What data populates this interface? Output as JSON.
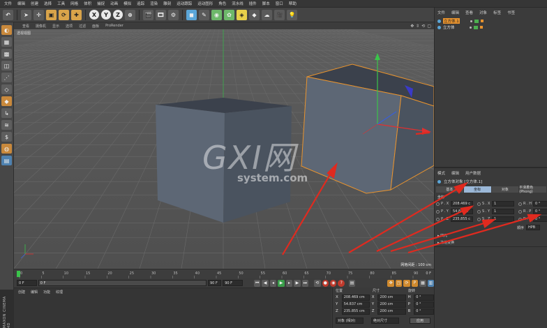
{
  "menubar": [
    "文件",
    "编辑",
    "创建",
    "选择",
    "工具",
    "网格",
    "体积",
    "捕捉",
    "动画",
    "模拟",
    "追踪",
    "渲染",
    "雕刻",
    "运动跟踪",
    "运动图形",
    "角色",
    "流水线",
    "插件",
    "脚本",
    "窗口",
    "帮助"
  ],
  "viewport": {
    "menu": [
      "查看",
      "摄像机",
      "显示",
      "选项",
      "过滤",
      "面板",
      "ProRender"
    ],
    "label": "透视视图",
    "grid_scale": "网格间距 : 100 cm"
  },
  "timeline": {
    "ticks": [
      "0",
      "5",
      "10",
      "15",
      "20",
      "25",
      "30",
      "35",
      "40",
      "45",
      "50",
      "55",
      "60",
      "65",
      "70",
      "75",
      "80",
      "85",
      "90"
    ],
    "end_label": "0 F"
  },
  "transport": {
    "start_frame": "0 F",
    "current_frame": "0 F",
    "end_frame": "90 F",
    "range_end": "90 F"
  },
  "material": {
    "menu": [
      "创建",
      "编辑",
      "功能",
      "纹理"
    ]
  },
  "coordinates": {
    "header_pos": "位置",
    "header_size": "尺寸",
    "header_rot": "旋转",
    "rows": [
      {
        "axis": "X",
        "pos": "208.469 cm",
        "size_axis": "X",
        "size": "200 cm",
        "rot_axis": "H",
        "rot": "0 °"
      },
      {
        "axis": "Y",
        "pos": "54.837 cm",
        "size_axis": "Y",
        "size": "200 cm",
        "rot_axis": "P",
        "rot": "0 °"
      },
      {
        "axis": "Z",
        "pos": "235.855 cm",
        "size_axis": "Z",
        "size": "200 cm",
        "rot_axis": "B",
        "rot": "0 °"
      }
    ],
    "mode": "对象 (相对)",
    "size_mode": "绝对尺寸",
    "apply": "应用"
  },
  "objects": {
    "menu": [
      "文件",
      "编辑",
      "查看",
      "对象",
      "标签",
      "书签"
    ],
    "items": [
      {
        "name": "立方体.1",
        "selected": true
      },
      {
        "name": "立方体",
        "selected": false
      }
    ]
  },
  "attributes": {
    "menu": [
      "模式",
      "编辑",
      "用户数据"
    ],
    "title": "立方体对象 [立方体.1]",
    "tabs": [
      "基本",
      "坐标",
      "对象",
      "平滑着色(Phong)"
    ],
    "active_tab": "坐标",
    "section": "坐标",
    "rows": [
      {
        "p": "P . X",
        "pv": "208.469 c",
        "s": "S . X",
        "sv": "1",
        "r": "R . H",
        "rv": "0 °"
      },
      {
        "p": "P . Y",
        "pv": "54.837 c",
        "s": "S . Y",
        "sv": "1",
        "r": "R . P",
        "rv": "0 °"
      },
      {
        "p": "P . Z",
        "pv": "235.855 c",
        "s": "S . Z",
        "sv": "1",
        "r": "R . B",
        "rv": "0 °"
      }
    ],
    "order_label": "顺序",
    "order_value": "HPB",
    "fold1": "▸ 四元",
    "fold2": "▸ 冻结变换"
  },
  "logo_text": "MAXON CINEMA 4D",
  "watermark": {
    "big": "GXI网",
    "small": "system.com"
  },
  "colors": {
    "accent": "#9bb8d8",
    "selection_orange": "#e8932e",
    "arrow_red": "#e02a1f"
  }
}
